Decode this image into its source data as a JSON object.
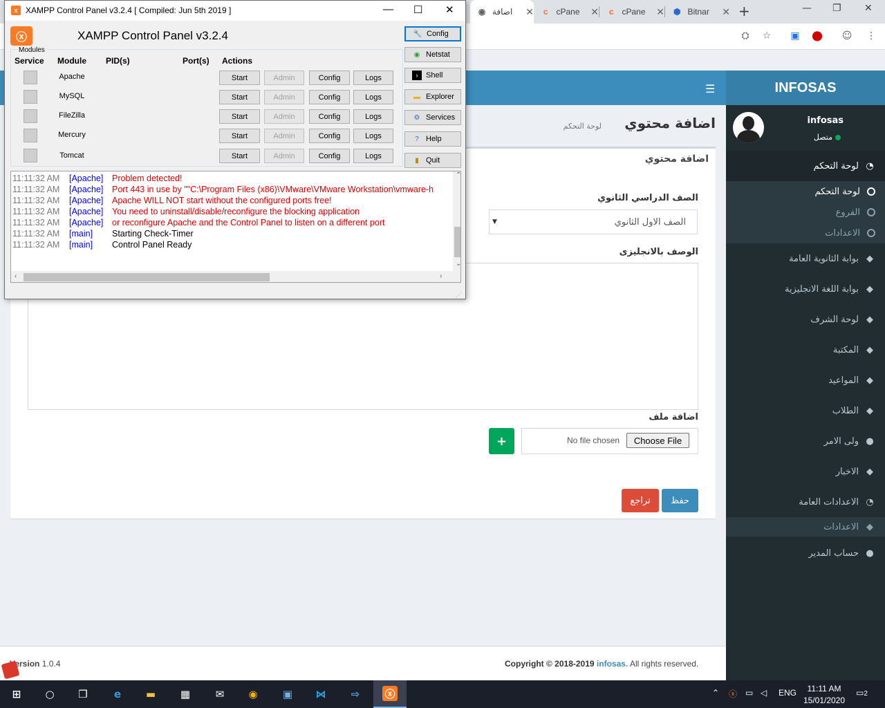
{
  "browser": {
    "tabs": [
      {
        "title": "اضافة",
        "icon": "globe-icon",
        "active": true
      },
      {
        "title": "cPane",
        "icon": "cpanel-icon",
        "active": false
      },
      {
        "title": "cPane",
        "icon": "cpanel-icon",
        "active": false
      },
      {
        "title": "Bitnar",
        "icon": "bitnami-icon",
        "active": false
      }
    ]
  },
  "app": {
    "brand": "INFOSAS",
    "user": {
      "name": "infosas",
      "status": "متصل"
    },
    "sidebar": {
      "items": [
        {
          "label": "لوحة التحكم",
          "icon": "dashboard-icon"
        },
        {
          "label": "بوابة الثانوية العامة",
          "icon": "tag-icon"
        },
        {
          "label": "بوابة اللغة الانجليزية",
          "icon": "tag-icon"
        },
        {
          "label": "لوحة الشرف",
          "icon": "tag-icon"
        },
        {
          "label": "المكتبة",
          "icon": "tag-icon"
        },
        {
          "label": "المواعيد",
          "icon": "tag-icon"
        },
        {
          "label": "الطلاب",
          "icon": "tag-icon"
        },
        {
          "label": "ولى الامر",
          "icon": "users-icon"
        },
        {
          "label": "الاخبار",
          "icon": "tag-icon"
        },
        {
          "label": "الاعدادات العامة",
          "icon": "dashboard-icon"
        },
        {
          "label": "الاعدادات",
          "icon": "tag-icon"
        },
        {
          "label": "حساب المدير",
          "icon": "users-icon"
        }
      ],
      "sub_items": [
        "لوحة التحكم",
        "الفروع",
        "الاعدادات"
      ]
    },
    "page": {
      "title": "اضافة محتوي",
      "breadcrumb": "لوحة التحكم",
      "box_title": "اضافة محتوي",
      "grade_label": "الصف الدراسي الثانوي",
      "grade_value": "الصف الاول الثانوي",
      "desc_label": "الوصف بالانجليزى",
      "file_label": "اضافة ملف",
      "no_file": "No file chosen",
      "choose_file": "Choose File",
      "add_symbol": "+",
      "save": "حفظ",
      "back": "تراجع"
    },
    "footer": {
      "version_prefix": "Version",
      "version": "1.0.4",
      "copyright": "Copyright © 2018-2019",
      "link": "infosas.",
      "rights": "All rights reserved."
    }
  },
  "xampp": {
    "window_title": "XAMPP Control Panel v3.2.4   [ Compiled: Jun 5th 2019 ]",
    "heading": "XAMPP Control Panel v3.2.4",
    "modules_label": "Modules",
    "columns": [
      "Service",
      "Module",
      "PID(s)",
      "Port(s)",
      "Actions"
    ],
    "modules": [
      "Apache",
      "MySQL",
      "FileZilla",
      "Mercury",
      "Tomcat"
    ],
    "actions": {
      "start": "Start",
      "admin": "Admin",
      "config": "Config",
      "logs": "Logs"
    },
    "side_buttons": [
      "Config",
      "Netstat",
      "Shell",
      "Explorer",
      "Services",
      "Help",
      "Quit"
    ],
    "log": [
      {
        "time": "11:11:32 AM",
        "module": "[Apache]",
        "text": "Problem detected!",
        "color": "#e00000"
      },
      {
        "time": "11:11:32 AM",
        "module": "[Apache]",
        "text": "Port 443 in use by \"\"C:\\Program Files (x86)\\VMware\\VMware Workstation\\vmware-h",
        "color": "#e00000"
      },
      {
        "time": "11:11:32 AM",
        "module": "[Apache]",
        "text": "Apache WILL NOT start without the configured ports free!",
        "color": "#e00000"
      },
      {
        "time": "11:11:32 AM",
        "module": "[Apache]",
        "text": "You need to uninstall/disable/reconfigure the blocking application",
        "color": "#e00000"
      },
      {
        "time": "11:11:32 AM",
        "module": "[Apache]",
        "text": "or reconfigure Apache and the Control Panel to listen on a different port",
        "color": "#e00000"
      },
      {
        "time": "11:11:32 AM",
        "module": "[main]",
        "text": "Starting Check-Timer",
        "color": "#000000"
      },
      {
        "time": "11:11:32 AM",
        "module": "[main]",
        "text": "Control Panel Ready",
        "color": "#000000"
      }
    ]
  },
  "taskbar": {
    "apps": [
      "start-icon",
      "cortana-icon",
      "task-view-icon",
      "edge-icon",
      "file-explorer-icon",
      "store-icon",
      "mail-icon",
      "chrome-icon",
      "remote-desktop-icon",
      "vscode-icon",
      "deploy-icon",
      "xampp-icon"
    ],
    "language": "ENG",
    "time": "11:11 AM",
    "date": "15/01/2020",
    "notifications": "2"
  }
}
